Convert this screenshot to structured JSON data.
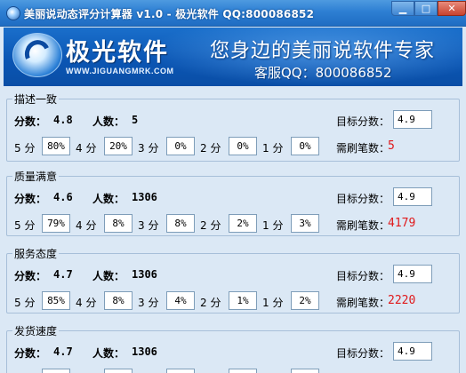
{
  "window": {
    "title": "美丽说动态评分计算器 v1.0 - 极光软件 QQ:800086852",
    "buttons": {
      "minimize": "▁",
      "maximize": "□",
      "close": "✕"
    }
  },
  "banner": {
    "brand": "极光软件",
    "url": "WWW.JIGUANGMRK.COM",
    "slogan": "您身边的美丽说软件专家",
    "service": "客服QQ：800086852"
  },
  "labels": {
    "score": "分数：",
    "count": "人数：",
    "target": "目标分数：",
    "need": "需刷笔数：",
    "s5": "5 分",
    "s4": "4 分",
    "s3": "3 分",
    "s2": "2 分",
    "s1": "1 分"
  },
  "groups": [
    {
      "title": "描述一致",
      "score": "4.8",
      "count": "5",
      "target": "4.9",
      "p5": "80%",
      "p4": "20%",
      "p3": "0%",
      "p2": "0%",
      "p1": "0%",
      "need": "5"
    },
    {
      "title": "质量满意",
      "score": "4.6",
      "count": "1306",
      "target": "4.9",
      "p5": "79%",
      "p4": "8%",
      "p3": "8%",
      "p2": "2%",
      "p1": "3%",
      "need": "4179"
    },
    {
      "title": "服务态度",
      "score": "4.7",
      "count": "1306",
      "target": "4.9",
      "p5": "85%",
      "p4": "8%",
      "p3": "4%",
      "p2": "1%",
      "p1": "2%",
      "need": "2220"
    },
    {
      "title": "发货速度",
      "score": "4.7",
      "count": "1306",
      "target": "4.9",
      "p5": "",
      "p4": "",
      "p3": "",
      "p2": "",
      "p1": "",
      "need": ""
    }
  ],
  "colors": {
    "need_value": "#e0181a",
    "titlebar": "#2d7fd3",
    "banner": "#0b56b4",
    "background": "#dbe8f5"
  }
}
